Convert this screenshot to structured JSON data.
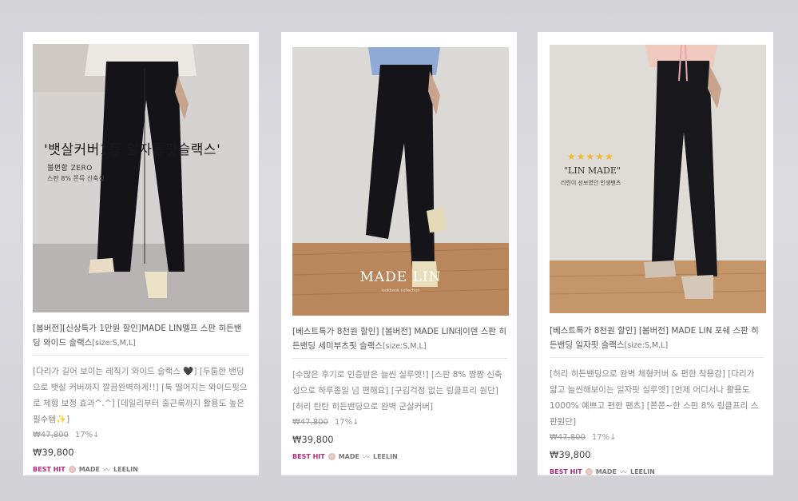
{
  "products": [
    {
      "overlay": {
        "headline": "'뱃살커버1등 일자통핏슬랙스'",
        "sub1": "불편함 ZERO",
        "sub2": "스판 8% 쫀득 신축성"
      },
      "name": "[봄버전][신상특가 1만원 할인]MADE LIN멜프 스판 히든밴딩 와이드 슬랙스",
      "size": "[size:S,M,L]",
      "description": "[다리가 길어 보이는 레직기 와이드 슬랙스 🖤] [두툼한 밴딩으로 뱃살 커버까지 깔끔완벽하게!!] [툭 떨어지는 와이드핏으로 체형 보정 효과^.^] [데일리부터 출근룩까지 활용도 높은 필수템✨]",
      "original_price": "₩47,800",
      "discount": "17%↓",
      "price": "₩39,800",
      "badges": {
        "best": "BEST HIT",
        "made": "MADE",
        "brand": "LEELIN"
      }
    },
    {
      "overlay": {
        "made": "MADE LIN",
        "made_small": "lookbook collection"
      },
      "name": "[베스트특가 8천원 할인] [봄버전] MADE LIN데이덴 스판 히든밴딩 세미부츠핏 슬랙스",
      "size": "[size:S,M,L]",
      "description": "[수많은 후기로 인증받은 늘씬 실루엣!] [스판 8% 짱짱 신축성으로 하루종일 넘 편해요] [구김걱정 없는 링클프리 원단] [허리 탄탄 히든밴딩으로 완벽 군살커버]",
      "original_price": "₩47,800",
      "discount": "17%↓",
      "price": "₩39,800",
      "badges": {
        "best": "BEST HIT",
        "made": "MADE",
        "brand": "LEELIN"
      }
    },
    {
      "overlay": {
        "stars": "★★★★★",
        "made": "\"LIN MADE\"",
        "sub": "리린이 선보였던 인생팬츠"
      },
      "name": "[베스트특가 8천원 할인] [봄버전] MADE LIN 포쉐 스판 히든밴딩 일자핏 슬랙스",
      "size": "[size:S,M,L]",
      "description": "[허리 히든밴딩으로 완벽 체형커버 & 편한 착용감] [다리가 얇고 늘씬해보이는 일자핏 실루엣] [언제 어디서나 활용도 1000% 예쁘고 편한 팬츠] [쫀쫀~한 스판 8% 링클프리 스판원단]",
      "original_price": "₩47,800",
      "discount": "17%↓",
      "price": "₩39,800",
      "badges": {
        "best": "BEST HIT",
        "made": "MADE",
        "brand": "LEELIN"
      }
    }
  ],
  "colors": {
    "background": "#d6d6da",
    "card": "#ffffff",
    "best_hit": "#b2297b",
    "pants": "#141418",
    "floor_wood": "#b9875b"
  },
  "icons": [
    "heart-icon",
    "sparkle-icon",
    "pink-dot-icon",
    "wave-icon",
    "star-icon"
  ]
}
